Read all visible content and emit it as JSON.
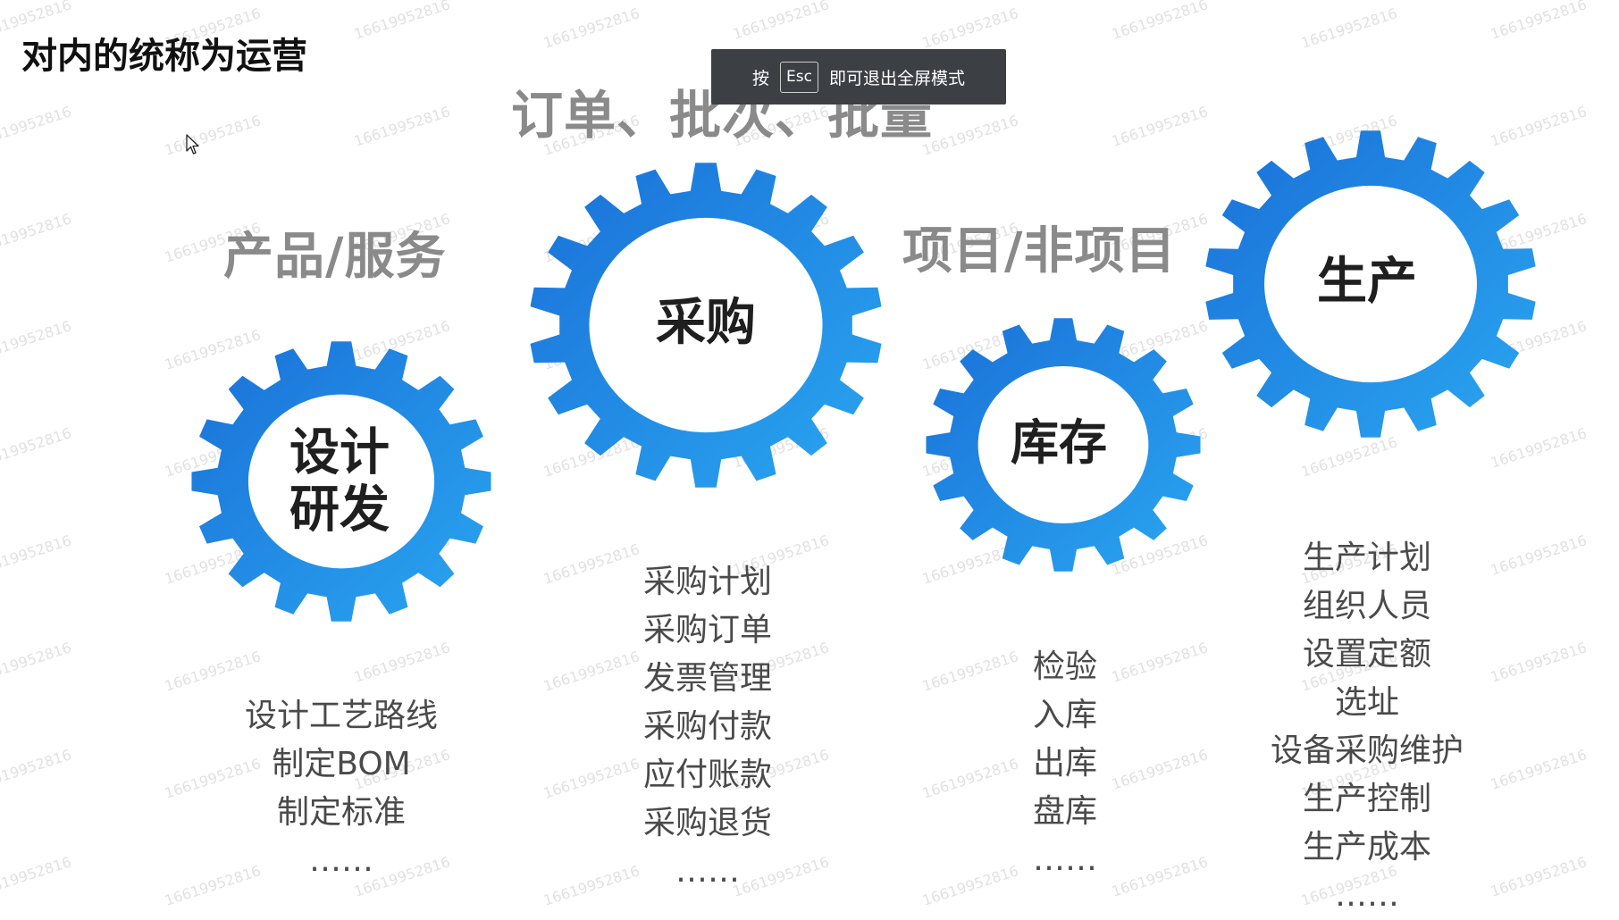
{
  "slide": {
    "title": "对内的统称为运营"
  },
  "fullscreen_notice": {
    "prefix": "按",
    "key": "Esc",
    "suffix": "即可退出全屏模式"
  },
  "headings": {
    "product_service": "产品/服务",
    "order_batch": "订单、批次、批量",
    "project": "项目/非项目"
  },
  "gears": {
    "design": {
      "line1": "设计",
      "line2": "研发",
      "color_dark": "#1a70d8",
      "color_light": "#2aa6f0"
    },
    "purchase": {
      "label": "采购",
      "color_dark": "#1a70d8",
      "color_light": "#2aa6f0"
    },
    "inventory": {
      "label": "库存",
      "color_dark": "#1a70d8",
      "color_light": "#2aa6f0"
    },
    "production": {
      "label": "生产",
      "color_dark": "#1a70d8",
      "color_light": "#2aa6f0"
    }
  },
  "lists": {
    "design": [
      "设计工艺路线",
      "制定BOM",
      "制定标准",
      "……"
    ],
    "purchase": [
      "采购计划",
      "采购订单",
      "发票管理",
      "采购付款",
      "应付账款",
      "采购退货",
      "……"
    ],
    "inventory": [
      "检验",
      "入库",
      "出库",
      "盘库",
      "……"
    ],
    "production": [
      "生产计划",
      "组织人员",
      "设置定额",
      "选址",
      "设备采购维护",
      "生产控制",
      "生产成本",
      "……"
    ]
  },
  "watermark": "16619952816"
}
